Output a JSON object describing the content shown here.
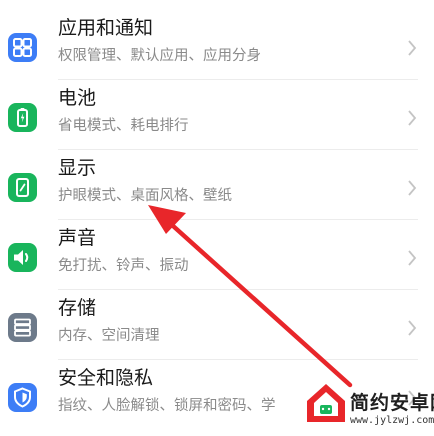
{
  "settings": {
    "items": [
      {
        "title": "应用和通知",
        "subtitle": "权限管理、默认应用、应用分身",
        "icon": "apps-grid-icon",
        "color": "#3d7df6"
      },
      {
        "title": "电池",
        "subtitle": "省电模式、耗电排行",
        "icon": "battery-icon",
        "color": "#19b55c"
      },
      {
        "title": "显示",
        "subtitle": "护眼模式、桌面风格、壁纸",
        "icon": "display-phone-icon",
        "color": "#19b55c"
      },
      {
        "title": "声音",
        "subtitle": "免打扰、铃声、振动",
        "icon": "speaker-icon",
        "color": "#19b55c"
      },
      {
        "title": "存储",
        "subtitle": "内存、空间清理",
        "icon": "storage-icon",
        "color": "#6d7a8a"
      },
      {
        "title": "安全和隐私",
        "subtitle": "指纹、人脸解锁、锁屏和密码、学",
        "icon": "shield-icon",
        "color": "#3d7df6"
      }
    ]
  },
  "annotation": {
    "arrow_color": "#e8262a"
  },
  "watermark": {
    "name": "简约安卓网",
    "url": "www.jylzwj.com"
  }
}
